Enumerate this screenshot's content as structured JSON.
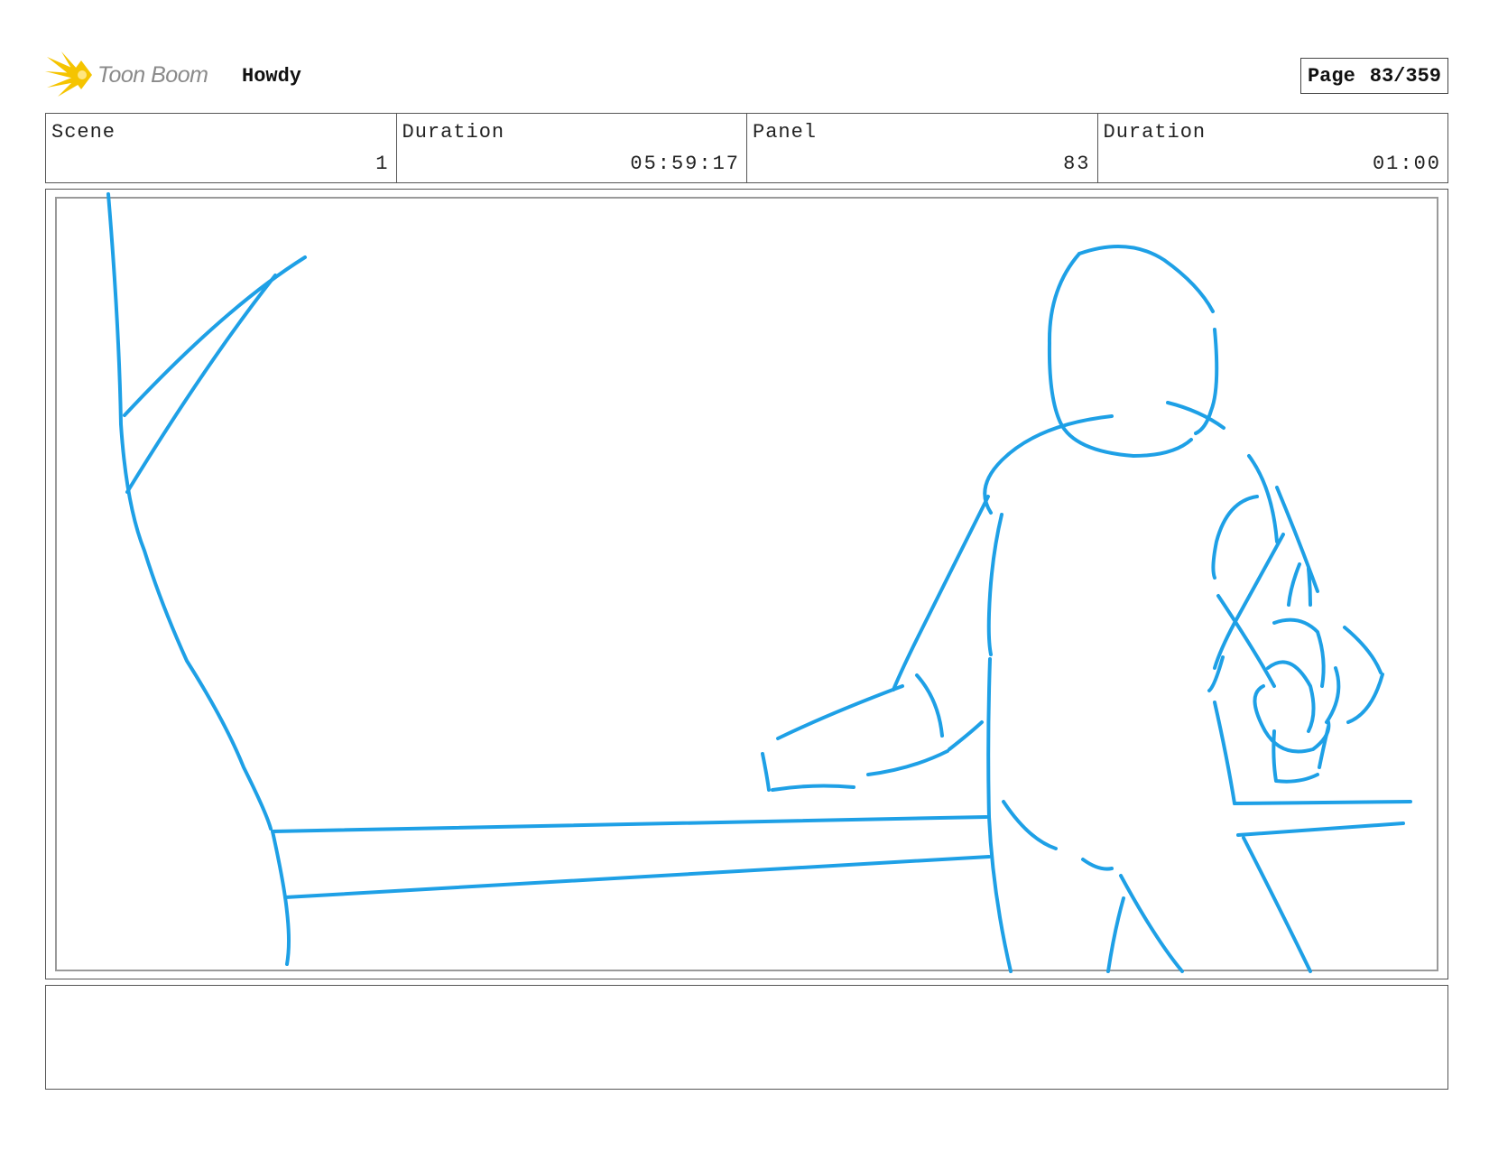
{
  "header": {
    "logo_text": "Toon Boom",
    "project_title": "Howdy",
    "page_label": "Page",
    "page_value": "83/359"
  },
  "info": {
    "scene_label": "Scene",
    "scene_value": "1",
    "scene_duration_label": "Duration",
    "scene_duration_value": "05:59:17",
    "panel_label": "Panel",
    "panel_value": "83",
    "panel_duration_label": "Duration",
    "panel_duration_value": "01:00"
  },
  "colors": {
    "sketch_stroke": "#1ea0e6",
    "logo_yellow": "#f5c400",
    "logo_text": "#8a8a8a"
  },
  "icons": {
    "logo": "toon-boom-star-icon"
  },
  "notes": {
    "text": ""
  }
}
